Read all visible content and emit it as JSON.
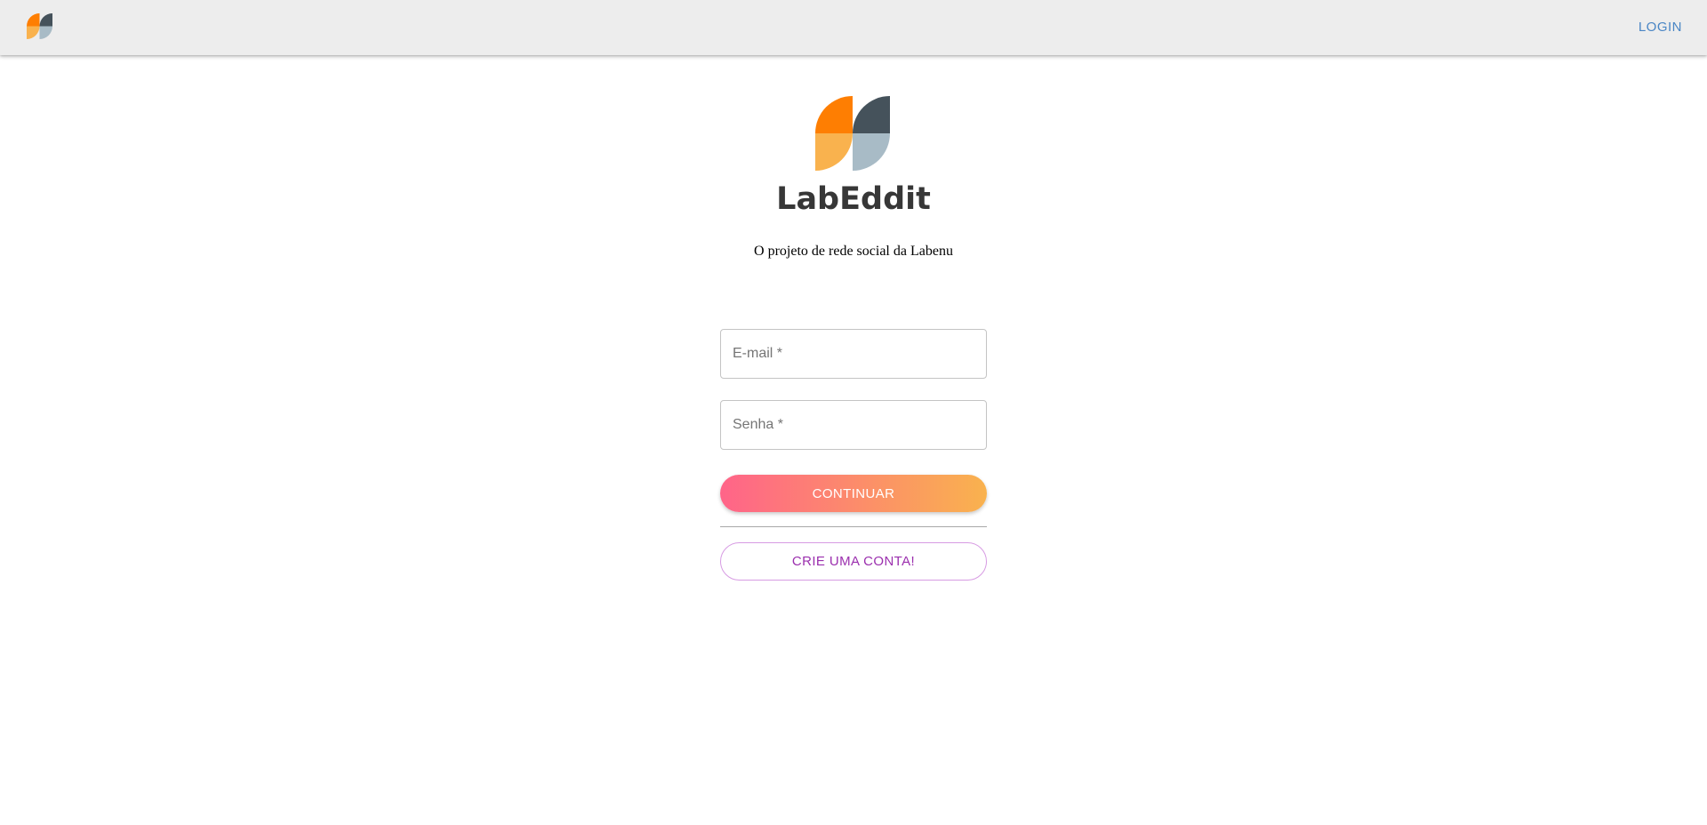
{
  "header": {
    "logo_icon": "labenu-logo-icon",
    "login_label": "LOGIN"
  },
  "main": {
    "logo_icon": "labenu-logo-icon",
    "title": "LabEddit",
    "subtitle": "O projeto de rede social da Labenu"
  },
  "form": {
    "email": {
      "placeholder": "E-mail *",
      "value": ""
    },
    "password": {
      "placeholder": "Senha *",
      "value": ""
    },
    "continue_label": "CONTINUAR",
    "signup_label": "CRIE UMA CONTA!"
  },
  "colors": {
    "logo_orange_dark": "#fe7e02",
    "logo_orange_light": "#f9b24e",
    "logo_slate_dark": "#45525b",
    "logo_slate_light": "#a8bbc6",
    "login_link": "#4a86c5",
    "button_gradient_start": "#ff6489",
    "button_gradient_end": "#f9b24e",
    "signup_text": "#9b2fae"
  }
}
